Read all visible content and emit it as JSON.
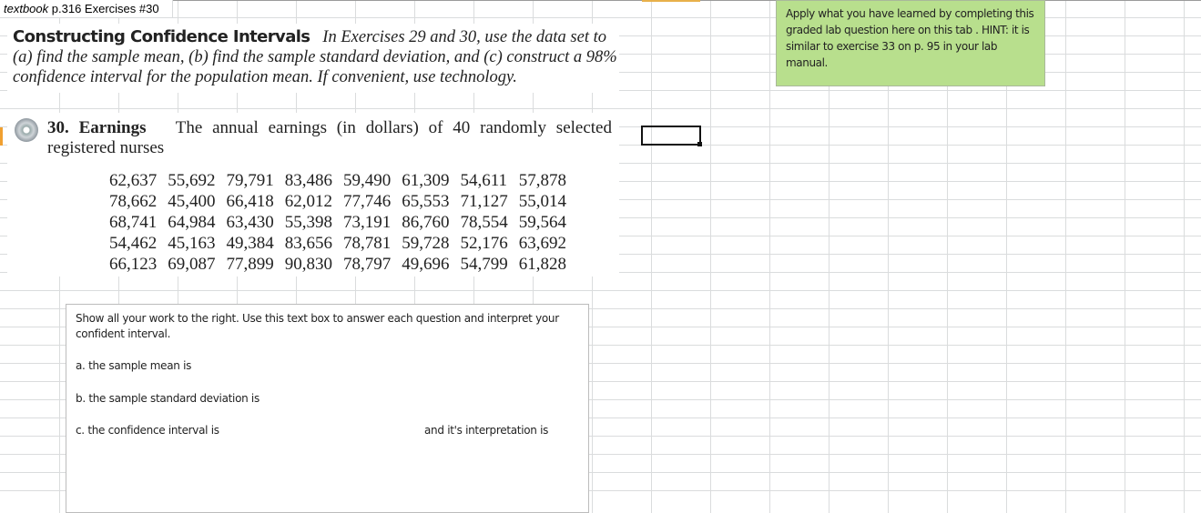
{
  "cell_label": {
    "italic": "textbook",
    "rest": " p.316 Exercises #30"
  },
  "heading": {
    "bold": "Constructing Confidence Intervals",
    "italic": "In Exercises 29 and 30, use the data set to (a) find the sample mean, (b) find the sample standard deviation, and (c) construct a 98% confidence interval for the population mean. If convenient, use technology."
  },
  "exercise": {
    "number": "30.",
    "title": "Earnings",
    "text": "The annual earnings (in dollars) of 40 randomly selected registered nurses"
  },
  "data_rows": [
    [
      "62,637",
      "55,692",
      "79,791",
      "83,486",
      "59,490",
      "61,309",
      "54,611",
      "57,878"
    ],
    [
      "78,662",
      "45,400",
      "66,418",
      "62,012",
      "77,746",
      "65,553",
      "71,127",
      "55,014"
    ],
    [
      "68,741",
      "64,984",
      "63,430",
      "55,398",
      "73,191",
      "86,760",
      "78,554",
      "59,564"
    ],
    [
      "54,462",
      "45,163",
      "49,384",
      "83,656",
      "78,781",
      "59,728",
      "52,176",
      "63,692"
    ],
    [
      "66,123",
      "69,087",
      "77,899",
      "90,830",
      "78,797",
      "49,696",
      "54,799",
      "61,828"
    ]
  ],
  "answer_box": {
    "intro": "Show all your work to the right.  Use this text box to answer each question and interpret your confident interval.",
    "a": "a. the sample mean is",
    "b": "b. the sample standard deviation is",
    "c": "c.  the confidence interval is",
    "c_interp": "and it's interpretation is"
  },
  "note": "Apply what you have learned by completing this graded lab question here on this tab .  HINT:  it is similar to exercise 33 on p. 95  in your lab manual.",
  "colors": {
    "note_bg": "#b8df8d",
    "grid": "#dadcdd"
  }
}
